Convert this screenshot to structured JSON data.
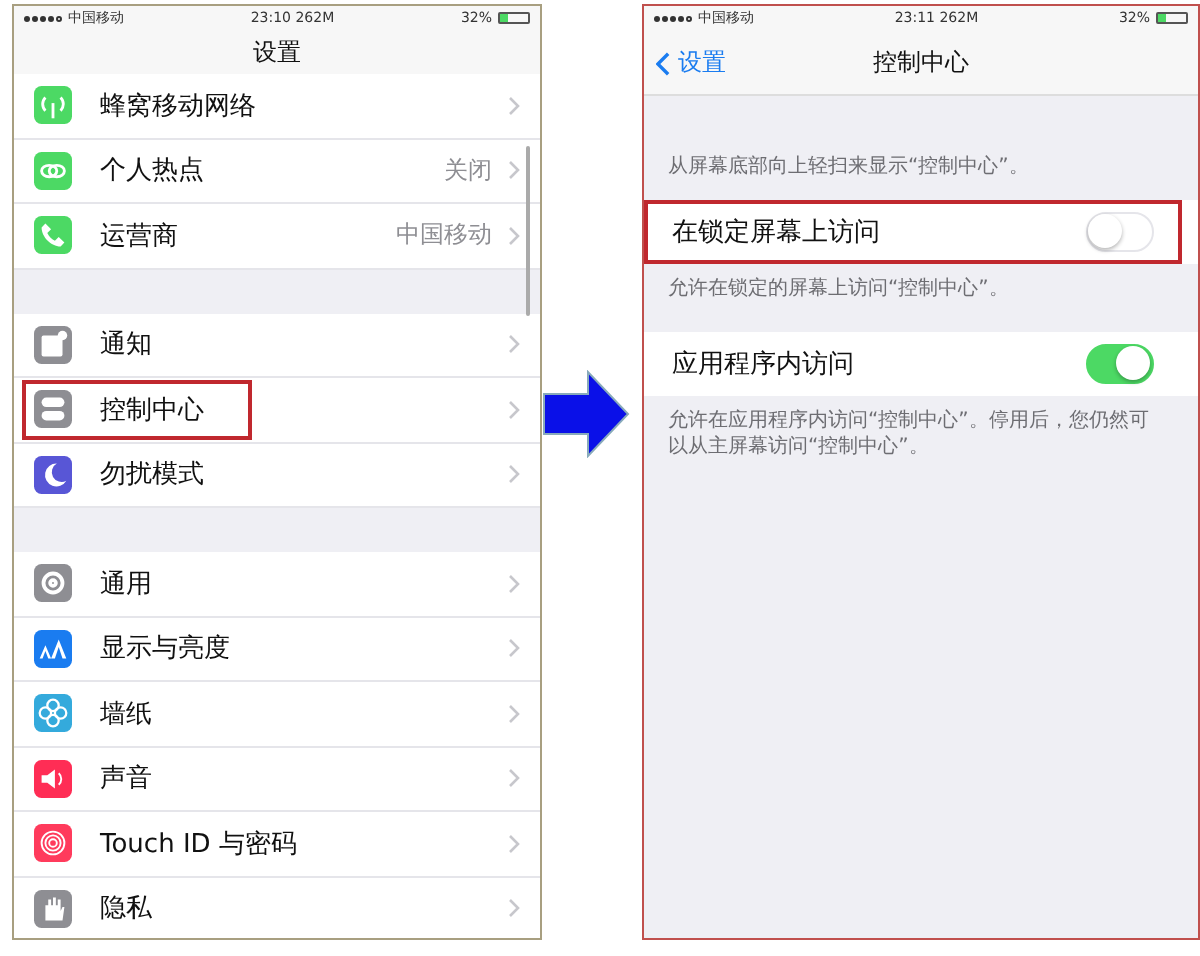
{
  "left_screen": {
    "status_bar": {
      "carrier": "中国移动",
      "time": "23:10 262M",
      "battery": "32%"
    },
    "title": "设置",
    "groups": [
      {
        "items": [
          {
            "label": "蜂窝移动网络",
            "kind": "antenna",
            "color": "#4cd964",
            "highlighted": false
          },
          {
            "label": "个人热点",
            "value": "关闭",
            "kind": "link",
            "color": "#4cd964",
            "highlighted": false
          },
          {
            "label": "运营商",
            "value": "中国移动",
            "kind": "phone",
            "color": "#4cd964",
            "highlighted": false
          }
        ]
      },
      {
        "items": [
          {
            "label": "通知",
            "kind": "notice",
            "color": "#8e8e93",
            "highlighted": false
          },
          {
            "label": "控制中心",
            "kind": "switches",
            "color": "#8e8e93",
            "highlighted": true
          },
          {
            "label": "勿扰模式",
            "kind": "moon",
            "color": "#5856d6",
            "highlighted": false
          }
        ]
      },
      {
        "items": [
          {
            "label": "通用",
            "kind": "gear",
            "color": "#8e8e93",
            "highlighted": false
          },
          {
            "label": "显示与亮度",
            "kind": "textsize",
            "color": "#1a7cf0",
            "highlighted": false
          },
          {
            "label": "墙纸",
            "kind": "flower",
            "color": "#34aadc",
            "highlighted": false
          },
          {
            "label": "声音",
            "kind": "speaker",
            "color": "#ff2d55",
            "highlighted": false
          },
          {
            "label": "Touch ID 与密码",
            "kind": "fingerprint",
            "color": "#ff3b5c",
            "highlighted": false
          },
          {
            "label": "隐私",
            "kind": "hand",
            "color": "#8e8e93",
            "highlighted": false
          }
        ]
      }
    ]
  },
  "right_screen": {
    "status_bar": {
      "carrier": "中国移动",
      "time": "23:11 262M",
      "battery": "32%"
    },
    "back": "设置",
    "title": "控制中心",
    "intro": "从屏幕底部向上轻扫来显示“控制中心”。",
    "settings": [
      {
        "label": "在锁定屏幕上访问",
        "on": false,
        "highlighted": true,
        "note": "允许在锁定的屏幕上访问“控制中心”。"
      },
      {
        "label": "应用程序内访问",
        "on": true,
        "highlighted": false,
        "note": "允许在应用程序内访问“控制中心”。停用后，您仍然可以从主屏幕访问“控制中心”。"
      }
    ]
  }
}
